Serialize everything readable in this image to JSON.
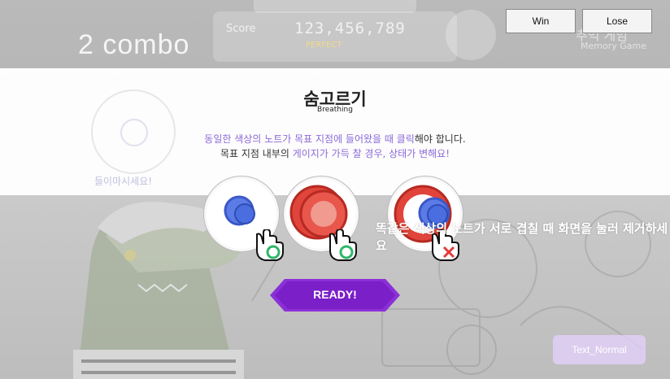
{
  "hud": {
    "combo": "2 combo",
    "score_label": "Score",
    "score_value": "123,456,789",
    "perfect_text": "PERFECT",
    "right_title": "추억 게임",
    "right_subtitle": "Memory Game"
  },
  "tutorial": {
    "title": "숨고르기",
    "subtitle": "Breathing",
    "line1_hl": "동일한 색상의 노트가 목표 지점에 들어왔을 때 클릭",
    "line1_rest": "해야 합니다.",
    "line2_pre": "목표 지점 내부의 ",
    "line2_hl": "게이지가 가득 찰 경우, 상태가 변해요!",
    "faded_caption": "들이마시세요!"
  },
  "examples": [
    {
      "note_color": "#4a6ee0",
      "result": "correct"
    },
    {
      "note_color": "#e0443a",
      "result": "correct"
    },
    {
      "note_color": "#4a6ee0",
      "result": "wrong"
    }
  ],
  "overlay_hint": "똑같은 색상의 노트가 서로 겹칠 때 화면을 눌러 제거하세요",
  "ready_label": "READY!",
  "debug": {
    "win": "Win",
    "lose": "Lose"
  },
  "text_normal": "Text_Normal",
  "colors": {
    "accent_purple": "#8b2fd8",
    "blue_note": "#4a6ee0",
    "red_note": "#e0443a",
    "ok_green": "#2fb56a",
    "fail_red": "#e23b3b",
    "highlight_text": "#8c6ad8"
  }
}
